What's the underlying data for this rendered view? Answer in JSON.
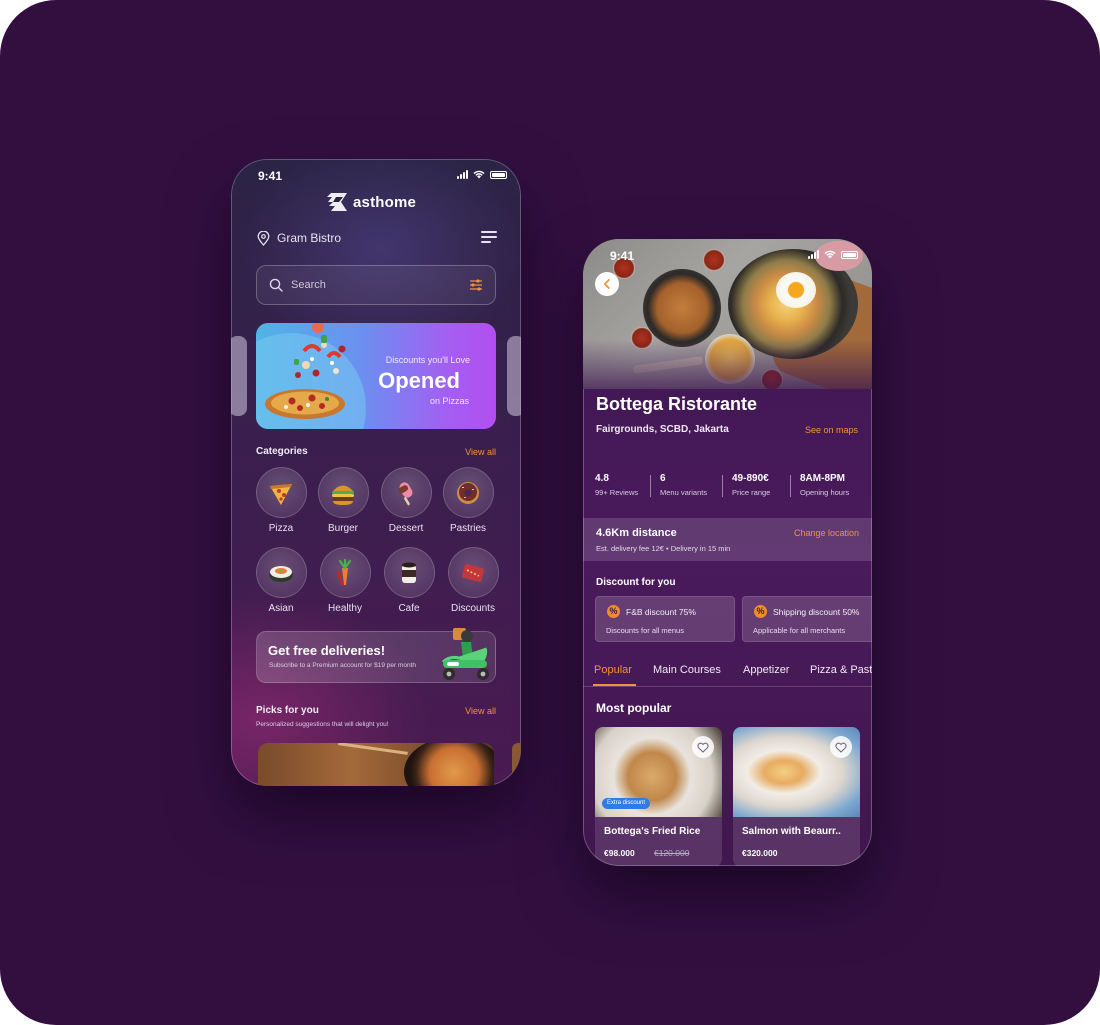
{
  "colors": {
    "background": "#330f40",
    "accent_orange": "#f3923a",
    "badge_blue": "#2f7bea",
    "banner_start": "#4fb4e6",
    "banner_end": "#b24ef0"
  },
  "home": {
    "status_time": "9:41",
    "logo_text": "asthome",
    "location": "Gram Bistro",
    "search_placeholder": "Search",
    "banner": {
      "subtitle": "Discounts you'll Love",
      "title": "Opened",
      "caption": "on Pizzas"
    },
    "categories_title": "Categories",
    "categories_view_all": "View all",
    "categories": [
      {
        "label": "Pizza",
        "icon": "pizza-icon"
      },
      {
        "label": "Burger",
        "icon": "burger-icon"
      },
      {
        "label": "Dessert",
        "icon": "ice-cream-icon"
      },
      {
        "label": "Pastries",
        "icon": "donut-icon"
      },
      {
        "label": "Asian",
        "icon": "sushi-icon"
      },
      {
        "label": "Healthy",
        "icon": "carrot-icon"
      },
      {
        "label": "Cafe",
        "icon": "coffee-icon"
      },
      {
        "label": "Discounts",
        "icon": "coupon-icon"
      }
    ],
    "promo": {
      "title": "Get free deliveries!",
      "subtitle": "Subscribe to a Premium account for $19 per month"
    },
    "picks_title": "Picks for you",
    "picks_view_all": "View all",
    "picks_subtitle": "Personalized suggestions that will delight you!"
  },
  "detail": {
    "status_time": "9:41",
    "name": "Bottega Ristorante",
    "address": "Fairgrounds, SCBD, Jakarta",
    "see_on_maps": "See on maps",
    "stats": [
      {
        "value": "4.8",
        "label": "99+ Reviews"
      },
      {
        "value": "6",
        "label": "Menu variants"
      },
      {
        "value": "49-890€",
        "label": "Price range"
      },
      {
        "value": "8AM-8PM",
        "label": "Opening hours"
      }
    ],
    "distance": {
      "title": "4.6Km distance",
      "subtitle": "Est. delivery fee 12€  •  Delivery in 15 min",
      "change": "Change location"
    },
    "discount_title": "Discount for you",
    "discounts": [
      {
        "name": "F&B discount 75%",
        "desc": "Discounts for all menus"
      },
      {
        "name": "Shipping discount 50%",
        "desc": "Applicable for all merchants"
      }
    ],
    "tabs": [
      "Popular",
      "Main Courses",
      "Appetizer",
      "Pizza & Past"
    ],
    "most_popular_title": "Most popular",
    "items": [
      {
        "name": "Bottega's Fried Rice",
        "price": "€98.000",
        "old_price": "€120.000",
        "badge": "Extra discount"
      },
      {
        "name": "Salmon with Beaurr..",
        "price": "€320.000"
      }
    ]
  }
}
